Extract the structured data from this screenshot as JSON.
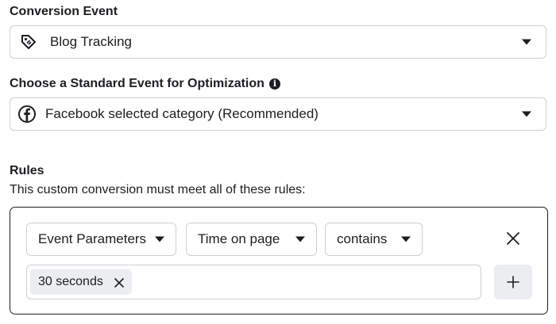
{
  "conversion_event": {
    "label": "Conversion Event",
    "selected": "Blog Tracking",
    "icon": "tag-icon"
  },
  "standard_event": {
    "label": "Choose a Standard Event for Optimization",
    "info_glyph": "i",
    "selected": "Facebook selected category (Recommended)",
    "icon": "facebook-icon"
  },
  "rules": {
    "title": "Rules",
    "description": "This custom conversion must meet all of these rules:",
    "rule": {
      "field_select": "Event Parameters",
      "parameter_select": "Time on page",
      "operator_select": "contains",
      "value_chip": "30 seconds"
    }
  }
}
